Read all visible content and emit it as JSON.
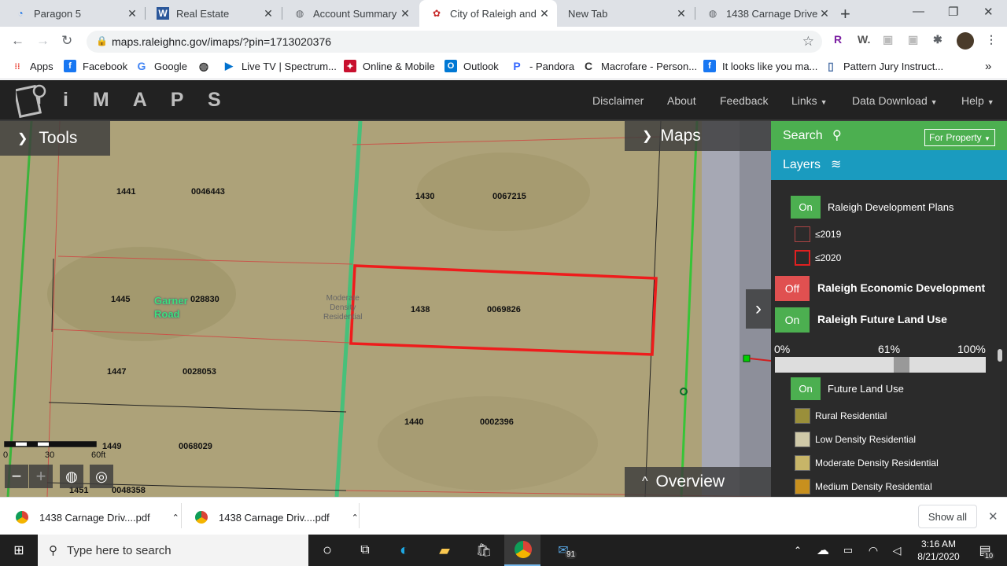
{
  "browser": {
    "tabs": [
      {
        "title": "Paragon 5",
        "icon": "paragon-icon"
      },
      {
        "title": "Real Estate",
        "icon": "word-icon"
      },
      {
        "title": "Account Summary - I",
        "icon": "globe-icon"
      },
      {
        "title": "City of Raleigh and W",
        "icon": "raleigh-icon"
      },
      {
        "title": "New Tab",
        "icon": ""
      },
      {
        "title": "1438 Carnage Drive I",
        "icon": "globe-icon"
      }
    ],
    "url": "maps.raleighnc.gov/imaps/?pin=1713020376",
    "bookmarks": [
      "Apps",
      "Facebook",
      "Google",
      "Live TV | Spectrum...",
      "Online & Mobile",
      "Outlook",
      "- Pandora",
      "Macrofare - Person...",
      "It looks like you ma...",
      "Pattern Jury Instruct..."
    ]
  },
  "app": {
    "logo": "iMAPS",
    "nav": [
      "Disclaimer",
      "About",
      "Feedback",
      "Links",
      "Data Download",
      "Help"
    ]
  },
  "map": {
    "tools_label": "Tools",
    "maps_label": "Maps",
    "overview_label": "Overview",
    "street_label": "Garner\nRoad",
    "landuse_label": "Moderate\nDensity\nResidential",
    "parcels": [
      {
        "num": "1441",
        "pin": "0046443"
      },
      {
        "num": "1430",
        "pin": "0067215"
      },
      {
        "num": "1445",
        "pin": "028830"
      },
      {
        "num": "1438",
        "pin": "0069826"
      },
      {
        "num": "1447",
        "pin": "0028053"
      },
      {
        "num": "1440",
        "pin": "0002396"
      },
      {
        "num": "1449",
        "pin": "0068029"
      },
      {
        "num": "1451",
        "pin": "0048358"
      }
    ],
    "scale": {
      "z": "0",
      "m": "30",
      "e": "60ft"
    }
  },
  "panel": {
    "search_label": "Search",
    "property_select": "For Property",
    "layers_label": "Layers",
    "dev_plans": {
      "state": "On",
      "label": "Raleigh Development Plans"
    },
    "legend_dev": [
      "≤2019",
      "≤2020"
    ],
    "econ": {
      "state": "Off",
      "label": "Raleigh Economic Development"
    },
    "future": {
      "state": "On",
      "label": "Raleigh Future Land Use"
    },
    "slider": {
      "min": "0%",
      "val": "61%",
      "max": "100%",
      "fraction": 0.61
    },
    "flu": {
      "state": "On",
      "label": "Future Land Use"
    },
    "flu_legend": [
      {
        "label": "Rural Residential",
        "color": "#9a8f3a"
      },
      {
        "label": "Low Density Residential",
        "color": "#cfc9a8"
      },
      {
        "label": "Moderate Density Residential",
        "color": "#c7b568"
      },
      {
        "label": "Medium Density Residential",
        "color": "#c8901e"
      }
    ]
  },
  "downloads": {
    "items": [
      "1438 Carnage Driv....pdf",
      "1438 Carnage Driv....pdf"
    ],
    "show_all": "Show all"
  },
  "taskbar": {
    "search_placeholder": "Type here to search",
    "time": "3:16 AM",
    "date": "8/21/2020",
    "mail_badge": "91",
    "notif_badge": "10"
  }
}
